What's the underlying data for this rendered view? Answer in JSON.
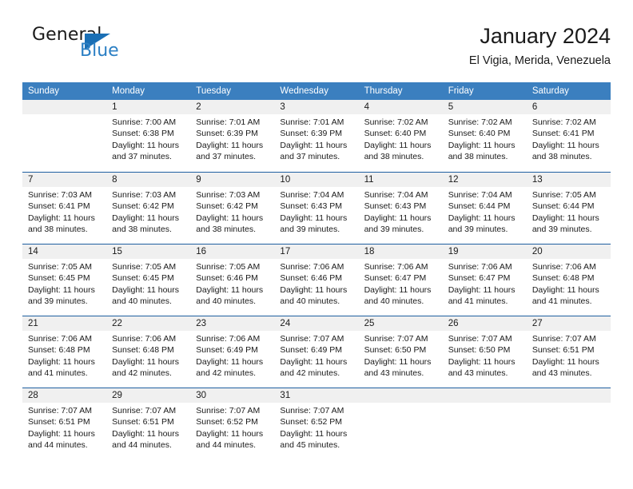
{
  "branding": {
    "logo_primary": "General",
    "logo_secondary": "Blue",
    "logo_icon": "triangle-icon"
  },
  "header": {
    "title": "January 2024",
    "subtitle": "El Vigia, Merida, Venezuela"
  },
  "weekdays": [
    "Sunday",
    "Monday",
    "Tuesday",
    "Wednesday",
    "Thursday",
    "Friday",
    "Saturday"
  ],
  "colors": {
    "header_blue": "#3b7fbf",
    "rule_blue": "#1f5fa0",
    "band_gray": "#f0f0f0",
    "logo_blue": "#2b7fc4",
    "text": "#1a1a1a"
  },
  "weeks": [
    {
      "days": [
        {
          "num": "",
          "lines": []
        },
        {
          "num": "1",
          "lines": [
            "Sunrise: 7:00 AM",
            "Sunset: 6:38 PM",
            "Daylight: 11 hours",
            "and 37 minutes."
          ]
        },
        {
          "num": "2",
          "lines": [
            "Sunrise: 7:01 AM",
            "Sunset: 6:39 PM",
            "Daylight: 11 hours",
            "and 37 minutes."
          ]
        },
        {
          "num": "3",
          "lines": [
            "Sunrise: 7:01 AM",
            "Sunset: 6:39 PM",
            "Daylight: 11 hours",
            "and 37 minutes."
          ]
        },
        {
          "num": "4",
          "lines": [
            "Sunrise: 7:02 AM",
            "Sunset: 6:40 PM",
            "Daylight: 11 hours",
            "and 38 minutes."
          ]
        },
        {
          "num": "5",
          "lines": [
            "Sunrise: 7:02 AM",
            "Sunset: 6:40 PM",
            "Daylight: 11 hours",
            "and 38 minutes."
          ]
        },
        {
          "num": "6",
          "lines": [
            "Sunrise: 7:02 AM",
            "Sunset: 6:41 PM",
            "Daylight: 11 hours",
            "and 38 minutes."
          ]
        }
      ]
    },
    {
      "days": [
        {
          "num": "7",
          "lines": [
            "Sunrise: 7:03 AM",
            "Sunset: 6:41 PM",
            "Daylight: 11 hours",
            "and 38 minutes."
          ]
        },
        {
          "num": "8",
          "lines": [
            "Sunrise: 7:03 AM",
            "Sunset: 6:42 PM",
            "Daylight: 11 hours",
            "and 38 minutes."
          ]
        },
        {
          "num": "9",
          "lines": [
            "Sunrise: 7:03 AM",
            "Sunset: 6:42 PM",
            "Daylight: 11 hours",
            "and 38 minutes."
          ]
        },
        {
          "num": "10",
          "lines": [
            "Sunrise: 7:04 AM",
            "Sunset: 6:43 PM",
            "Daylight: 11 hours",
            "and 39 minutes."
          ]
        },
        {
          "num": "11",
          "lines": [
            "Sunrise: 7:04 AM",
            "Sunset: 6:43 PM",
            "Daylight: 11 hours",
            "and 39 minutes."
          ]
        },
        {
          "num": "12",
          "lines": [
            "Sunrise: 7:04 AM",
            "Sunset: 6:44 PM",
            "Daylight: 11 hours",
            "and 39 minutes."
          ]
        },
        {
          "num": "13",
          "lines": [
            "Sunrise: 7:05 AM",
            "Sunset: 6:44 PM",
            "Daylight: 11 hours",
            "and 39 minutes."
          ]
        }
      ]
    },
    {
      "days": [
        {
          "num": "14",
          "lines": [
            "Sunrise: 7:05 AM",
            "Sunset: 6:45 PM",
            "Daylight: 11 hours",
            "and 39 minutes."
          ]
        },
        {
          "num": "15",
          "lines": [
            "Sunrise: 7:05 AM",
            "Sunset: 6:45 PM",
            "Daylight: 11 hours",
            "and 40 minutes."
          ]
        },
        {
          "num": "16",
          "lines": [
            "Sunrise: 7:05 AM",
            "Sunset: 6:46 PM",
            "Daylight: 11 hours",
            "and 40 minutes."
          ]
        },
        {
          "num": "17",
          "lines": [
            "Sunrise: 7:06 AM",
            "Sunset: 6:46 PM",
            "Daylight: 11 hours",
            "and 40 minutes."
          ]
        },
        {
          "num": "18",
          "lines": [
            "Sunrise: 7:06 AM",
            "Sunset: 6:47 PM",
            "Daylight: 11 hours",
            "and 40 minutes."
          ]
        },
        {
          "num": "19",
          "lines": [
            "Sunrise: 7:06 AM",
            "Sunset: 6:47 PM",
            "Daylight: 11 hours",
            "and 41 minutes."
          ]
        },
        {
          "num": "20",
          "lines": [
            "Sunrise: 7:06 AM",
            "Sunset: 6:48 PM",
            "Daylight: 11 hours",
            "and 41 minutes."
          ]
        }
      ]
    },
    {
      "days": [
        {
          "num": "21",
          "lines": [
            "Sunrise: 7:06 AM",
            "Sunset: 6:48 PM",
            "Daylight: 11 hours",
            "and 41 minutes."
          ]
        },
        {
          "num": "22",
          "lines": [
            "Sunrise: 7:06 AM",
            "Sunset: 6:48 PM",
            "Daylight: 11 hours",
            "and 42 minutes."
          ]
        },
        {
          "num": "23",
          "lines": [
            "Sunrise: 7:06 AM",
            "Sunset: 6:49 PM",
            "Daylight: 11 hours",
            "and 42 minutes."
          ]
        },
        {
          "num": "24",
          "lines": [
            "Sunrise: 7:07 AM",
            "Sunset: 6:49 PM",
            "Daylight: 11 hours",
            "and 42 minutes."
          ]
        },
        {
          "num": "25",
          "lines": [
            "Sunrise: 7:07 AM",
            "Sunset: 6:50 PM",
            "Daylight: 11 hours",
            "and 43 minutes."
          ]
        },
        {
          "num": "26",
          "lines": [
            "Sunrise: 7:07 AM",
            "Sunset: 6:50 PM",
            "Daylight: 11 hours",
            "and 43 minutes."
          ]
        },
        {
          "num": "27",
          "lines": [
            "Sunrise: 7:07 AM",
            "Sunset: 6:51 PM",
            "Daylight: 11 hours",
            "and 43 minutes."
          ]
        }
      ]
    },
    {
      "days": [
        {
          "num": "28",
          "lines": [
            "Sunrise: 7:07 AM",
            "Sunset: 6:51 PM",
            "Daylight: 11 hours",
            "and 44 minutes."
          ]
        },
        {
          "num": "29",
          "lines": [
            "Sunrise: 7:07 AM",
            "Sunset: 6:51 PM",
            "Daylight: 11 hours",
            "and 44 minutes."
          ]
        },
        {
          "num": "30",
          "lines": [
            "Sunrise: 7:07 AM",
            "Sunset: 6:52 PM",
            "Daylight: 11 hours",
            "and 44 minutes."
          ]
        },
        {
          "num": "31",
          "lines": [
            "Sunrise: 7:07 AM",
            "Sunset: 6:52 PM",
            "Daylight: 11 hours",
            "and 45 minutes."
          ]
        },
        {
          "num": "",
          "lines": []
        },
        {
          "num": "",
          "lines": []
        },
        {
          "num": "",
          "lines": []
        }
      ]
    }
  ]
}
